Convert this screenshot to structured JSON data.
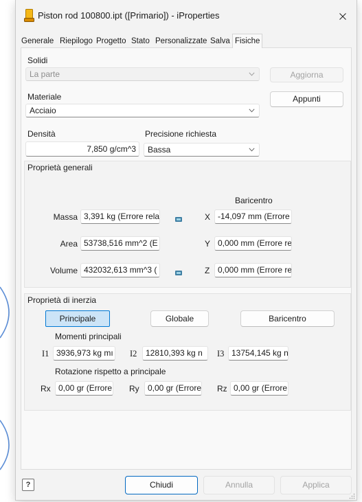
{
  "window": {
    "title": "Piston rod 100800.ipt ([Primario]) - iProperties"
  },
  "icons": {
    "app": "part-file-icon",
    "close": "close-icon",
    "dropdown": "chevron-down-icon",
    "value_override": "override-value-icon",
    "help": "help-icon",
    "resize": "resize-grip-icon"
  },
  "tabs": [
    {
      "label": "Generale",
      "active": false
    },
    {
      "label": "Riepilogo",
      "active": false
    },
    {
      "label": "Progetto",
      "active": false
    },
    {
      "label": "Stato",
      "active": false
    },
    {
      "label": "Personalizzate",
      "active": false
    },
    {
      "label": "Salva",
      "active": false
    },
    {
      "label": "Fisiche",
      "active": true
    }
  ],
  "physical": {
    "solids": {
      "label": "Solidi",
      "value": "La parte",
      "disabled": true
    },
    "update_button": {
      "label": "Aggiorna",
      "disabled": true
    },
    "material": {
      "label": "Materiale",
      "value": "Acciaio"
    },
    "clipboard_button": {
      "label": "Appunti",
      "disabled": false
    },
    "density": {
      "label": "Densità",
      "value": "7,850 g/cm^3"
    },
    "precision": {
      "label": "Precisione richiesta",
      "value": "Bassa"
    },
    "general": {
      "title": "Proprietà generali",
      "centroid_header": "Baricentro",
      "mass": {
        "label": "Massa",
        "value": "3,391 kg (Errore rela"
      },
      "area": {
        "label": "Area",
        "value": "53738,516 mm^2 (E"
      },
      "volume": {
        "label": "Volume",
        "value": "432032,613 mm^3 ("
      },
      "centroid_x": {
        "label": "X",
        "value": "-14,097 mm (Errore"
      },
      "centroid_y": {
        "label": "Y",
        "value": "0,000 mm (Errore re"
      },
      "centroid_z": {
        "label": "Z",
        "value": "0,000 mm (Errore re"
      }
    },
    "inertia": {
      "title": "Proprietà di inerzia",
      "view_buttons": [
        {
          "label": "Principale",
          "selected": true
        },
        {
          "label": "Globale",
          "selected": false
        },
        {
          "label": "Baricentro",
          "selected": false
        }
      ],
      "principal_moments": {
        "label": "Momenti principali",
        "i1": {
          "label": "I1",
          "value": "3936,973 kg mı"
        },
        "i2": {
          "label": "I2",
          "value": "12810,393 kg n"
        },
        "i3": {
          "label": "I3",
          "value": "13754,145 kg n"
        }
      },
      "rotation": {
        "label": "Rotazione rispetto a principale",
        "rx": {
          "label": "Rx",
          "value": "0,00 gr (Errore"
        },
        "ry": {
          "label": "Ry",
          "value": "0,00 gr (Errore"
        },
        "rz": {
          "label": "Rz",
          "value": "0,00 gr (Errore"
        }
      }
    }
  },
  "footer": {
    "help_label": "?",
    "close_button": {
      "label": "Chiudi",
      "disabled": false
    },
    "cancel_button": {
      "label": "Annulla",
      "disabled": true
    },
    "apply_button": {
      "label": "Applica",
      "disabled": true
    }
  },
  "theme": {
    "accent": "#0078d4",
    "selected_button_bg": "#cce4f7",
    "dialog_bg": "#f3f3f3",
    "background_arc": "#5b8dd6"
  }
}
